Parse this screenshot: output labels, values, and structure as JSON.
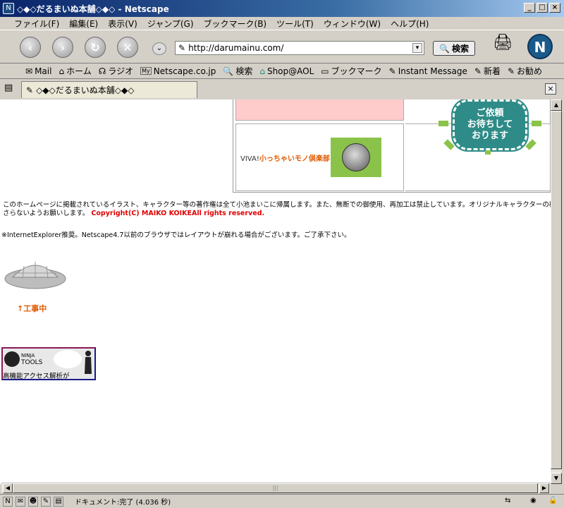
{
  "window": {
    "title": "◇◆◇だるまいぬ本舗◇◆◇ - Netscape",
    "buttons": {
      "minimize": "_",
      "maximize": "□",
      "close": "×"
    }
  },
  "menu": [
    "ファイル(F)",
    "編集(E)",
    "表示(V)",
    "ジャンプ(G)",
    "ブックマーク(B)",
    "ツール(T)",
    "ウィンドウ(W)",
    "ヘルプ(H)"
  ],
  "nav": {
    "url": "http://darumainu.com/",
    "search_label": "検索"
  },
  "bookmarks": [
    "Mail",
    "ホーム",
    "ラジオ",
    "Netscape.co.jp",
    "検索",
    "Shop@AOL",
    "ブックマーク",
    "Instant Message",
    "新着",
    "お勧め"
  ],
  "tab": {
    "title": "◇◆◇だるまいぬ本舗◇◆◇"
  },
  "page": {
    "banner_prefix": "VIVA!",
    "banner_link": "小っちゃいモノ倶楽部",
    "badge_text": [
      "ご依頼",
      "お待ちして",
      "おります"
    ],
    "copyright_line1": "このホームページに掲載されているイラスト、キャラクター等の著作権は全て小池まいこに帰属します。また、無断での御使用、再加工は禁止しています。オリジナルキャラクターの模倣も",
    "copyright_line2": "さらないようお願いします。",
    "copyright_red": "Copyright(C) MAIKO KOIKEAll rights reserved.",
    "browser_note": "※InternetExplorer推奨。Netscape4.7以前のブラウザではレイアウトが崩れる場合がございます。ご了承下さい。",
    "construction_label": "↑工事中",
    "ninja": {
      "line1": "NINJA",
      "line2": "TOOLS",
      "caption": "高機能アクセス解析が"
    }
  },
  "status": {
    "text": "ドキュメント:完了 (4.036 秒)"
  },
  "colors": {
    "accent_orange": "#e05a00",
    "badge_teal": "#2e8b87",
    "pink": "#ffcccc",
    "green": "#8bc34a"
  }
}
